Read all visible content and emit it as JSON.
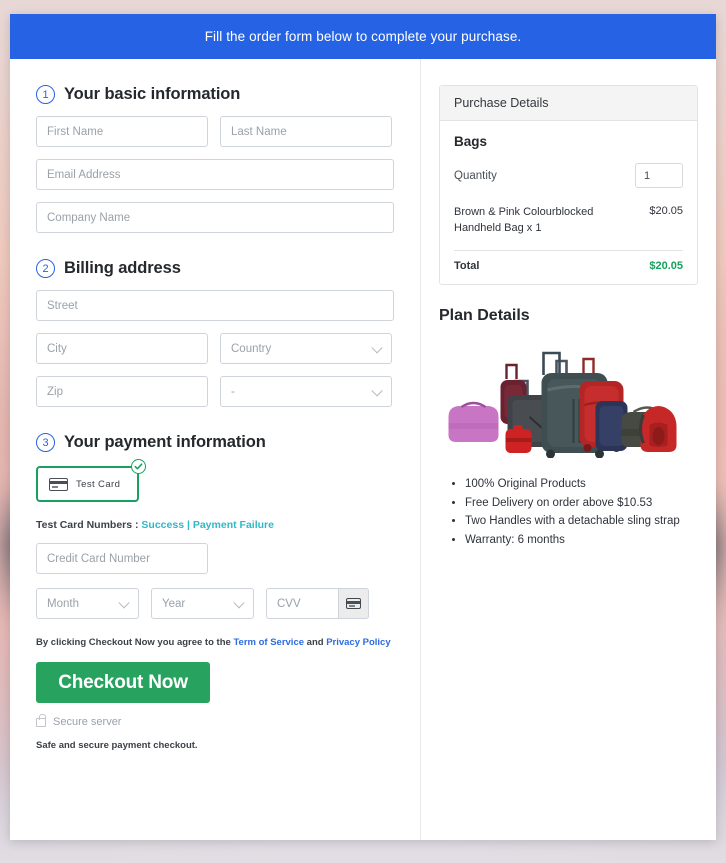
{
  "banner": {
    "text": "Fill the order form below to complete your purchase."
  },
  "sections": {
    "basic": {
      "number": "1",
      "title": "Your basic information",
      "fields": {
        "first_name": "First Name",
        "last_name": "Last Name",
        "email": "Email Address",
        "company": "Company Name"
      }
    },
    "billing": {
      "number": "2",
      "title": "Billing address",
      "fields": {
        "street": "Street",
        "city": "City",
        "country": "Country",
        "zip": "Zip",
        "state": "-"
      }
    },
    "payment": {
      "number": "3",
      "title": "Your payment information",
      "test_card_label": "Test Card",
      "test_numbers_label": "Test Card Numbers :",
      "success_link": "Success",
      "separator": "|",
      "failure_link": "Payment Failure",
      "card_number": "Credit Card Number",
      "month": "Month",
      "year": "Year",
      "cvv": "CVV"
    }
  },
  "footer": {
    "terms_prefix": "By clicking Checkout Now you agree to the",
    "terms_link": "Term of Service",
    "terms_and": "and",
    "privacy_link": "Privacy Policy",
    "checkout_button": "Checkout Now",
    "secure_server": "Secure server",
    "safe_note": "Safe and secure payment checkout."
  },
  "purchase": {
    "header": "Purchase Details",
    "product_group": "Bags",
    "quantity_label": "Quantity",
    "quantity_value": "1",
    "item_name": "Brown & Pink Colourblocked Handheld Bag x 1",
    "item_price": "$20.05",
    "total_label": "Total",
    "total_value": "$20.05"
  },
  "plan": {
    "title": "Plan Details",
    "image_alt": "luggage-set-image",
    "features": [
      "100% Original Products",
      "Free Delivery on order above $10.53",
      "Two Handles with a detachable sling strap",
      "Warranty: 6 months"
    ]
  },
  "colors": {
    "banner_blue": "#2563e4",
    "checkout_green": "#28a35f",
    "total_green": "#17a05e",
    "link_teal": "#2fb8c6",
    "link_blue": "#2d6cdf"
  }
}
